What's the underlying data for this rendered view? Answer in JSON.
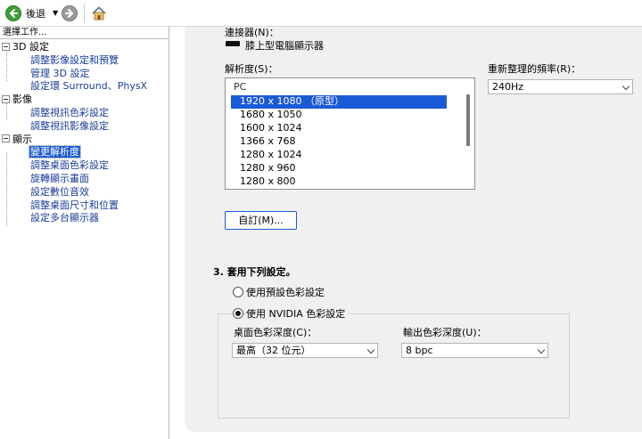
{
  "toolbar": {
    "back_label": "後退",
    "icons": [
      "back-arrow-icon",
      "forward-arrow-icon",
      "home-icon"
    ]
  },
  "left_pane": {
    "header": "選擇工作...",
    "categories": [
      {
        "label": "3D 設定",
        "items": [
          "調整影像設定和預覽",
          "管理 3D 設定",
          "設定環 Surround、PhysX"
        ]
      },
      {
        "label": "影像",
        "items": [
          "調整視訊色彩設定",
          "調整視訊影像設定"
        ]
      },
      {
        "label": "顯示",
        "items": [
          "變更解析度",
          "調整桌面色彩設定",
          "旋轉顯示畫面",
          "設定數位音效",
          "調整桌面尺寸和位置",
          "設定多台顯示器"
        ]
      }
    ],
    "selected_item": "變更解析度"
  },
  "main": {
    "connector_label": "連接器(N)：",
    "display_name": "膝上型電腦顯示器",
    "resolution_label": "解析度(S)：",
    "resolution_group": "PC",
    "resolutions": [
      "1920 x 1080 （原型）",
      "1680 x 1050",
      "1600 x 1024",
      "1366 x 768",
      "1280 x 1024",
      "1280 x 960",
      "1280 x 800"
    ],
    "refresh_label": "重新整理的頻率(R)：",
    "refresh_value": "240Hz",
    "custom_button": "自訂(M)...",
    "step3_title": "3. 套用下列設定。",
    "radio_default": "使用預設色彩設定",
    "radio_nvidia": "使用 NVIDIA 色彩設定",
    "desktop_depth_label": "桌面色彩深度(C)：",
    "desktop_depth_value": "最高（32 位元）",
    "output_depth_label": "輸出色彩深度(U)：",
    "output_depth_value": "8 bpc"
  },
  "colors": {
    "selection": "#1b5ad6",
    "link_text": "#1a3c99",
    "panel_bg": "#f0f0f0"
  }
}
